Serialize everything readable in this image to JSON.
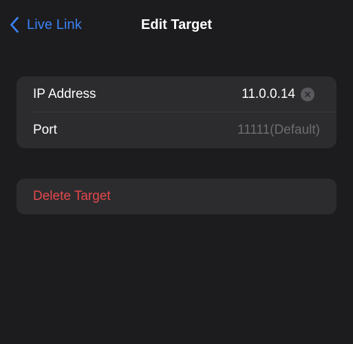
{
  "nav": {
    "back_label": "Live Link",
    "title": "Edit Target"
  },
  "form": {
    "ip": {
      "label": "IP Address",
      "value": "11.0.0.14"
    },
    "port": {
      "label": "Port",
      "placeholder": "11111(Default)"
    }
  },
  "actions": {
    "delete_label": "Delete Target"
  },
  "colors": {
    "background": "#1c1c1e",
    "group_background": "#2c2c2e",
    "accent": "#3c82f6",
    "destructive": "#e5484d",
    "placeholder": "#6d6d71"
  },
  "icons": {
    "back": "chevron-left-icon",
    "clear": "clear-circle-x-icon"
  }
}
